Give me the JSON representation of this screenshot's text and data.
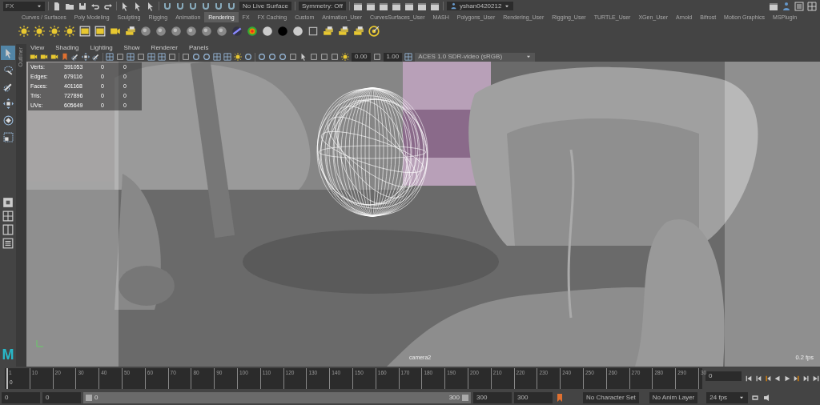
{
  "status_line": {
    "mode": "FX",
    "live_surface": "No Live Surface",
    "symmetry": "Symmetry: Off",
    "user": "yshan0420212"
  },
  "shelf_tabs": [
    {
      "label": "Curves / Surfaces",
      "selected": false
    },
    {
      "label": "Poly Modeling",
      "selected": false
    },
    {
      "label": "Sculpting",
      "selected": false
    },
    {
      "label": "Rigging",
      "selected": false
    },
    {
      "label": "Animation",
      "selected": false
    },
    {
      "label": "Rendering",
      "selected": true
    },
    {
      "label": "FX",
      "selected": false
    },
    {
      "label": "FX Caching",
      "selected": false
    },
    {
      "label": "Custom",
      "selected": false
    },
    {
      "label": "Animation_User",
      "selected": false
    },
    {
      "label": "CurvesSurfaces_User",
      "selected": false
    },
    {
      "label": "MASH",
      "selected": false
    },
    {
      "label": "Polygons_User",
      "selected": false
    },
    {
      "label": "Rendering_User",
      "selected": false
    },
    {
      "label": "Rigging_User",
      "selected": false
    },
    {
      "label": "TURTLE_User",
      "selected": false
    },
    {
      "label": "XGen_User",
      "selected": false
    },
    {
      "label": "Arnold",
      "selected": false
    },
    {
      "label": "Bifrost",
      "selected": false
    },
    {
      "label": "Motion Graphics",
      "selected": false
    },
    {
      "label": "MSPlugin",
      "selected": false
    }
  ],
  "toolbox": {
    "tools": [
      {
        "selected": true
      },
      {
        "selected": false
      },
      {
        "selected": false
      },
      {
        "selected": false
      },
      {
        "selected": false
      },
      {
        "selected": false
      }
    ],
    "logo": "M"
  },
  "outliner_tab": "Outliner",
  "panel_menu": [
    "View",
    "Shading",
    "Lighting",
    "Show",
    "Renderer",
    "Panels"
  ],
  "panel_toolbar": {
    "exposure": "0.00",
    "gamma": "1.00",
    "view_transform": "ACES 1.0 SDR-video (sRGB)"
  },
  "hud": {
    "rows": [
      {
        "label": "Verts:",
        "column_1": "391053",
        "column_2": "0",
        "column_3": "0"
      },
      {
        "label": "Edges:",
        "column_1": "679116",
        "column_2": "0",
        "column_3": "0"
      },
      {
        "label": "Faces:",
        "column_1": "401168",
        "column_2": "0",
        "column_3": "0"
      },
      {
        "label": "Tris:",
        "column_1": "727896",
        "column_2": "0",
        "column_3": "0"
      },
      {
        "label": "UVs:",
        "column_1": "605649",
        "column_2": "0",
        "column_3": "0"
      }
    ]
  },
  "camera_name": "camera2",
  "fps_readout": "0.2 fps",
  "time_slider": {
    "ticks": [
      "1",
      "10",
      "20",
      "30",
      "40",
      "50",
      "60",
      "70",
      "80",
      "90",
      "100",
      "110",
      "120",
      "130",
      "140",
      "150",
      "160",
      "170",
      "180",
      "190",
      "200",
      "210",
      "220",
      "230",
      "240",
      "250",
      "260",
      "270",
      "280",
      "290",
      "30"
    ],
    "current_frame_marker": "0",
    "current_frame": "0",
    "level": 0
  },
  "range_slider": {
    "start_time": "0",
    "playback_start": "0",
    "range_start": "0",
    "range_end": "300",
    "level": 1,
    "playback_end": "300",
    "end_time": "300",
    "character_set": "No Character Set",
    "anim_layer": "No Anim Layer",
    "fps": "24 fps"
  }
}
